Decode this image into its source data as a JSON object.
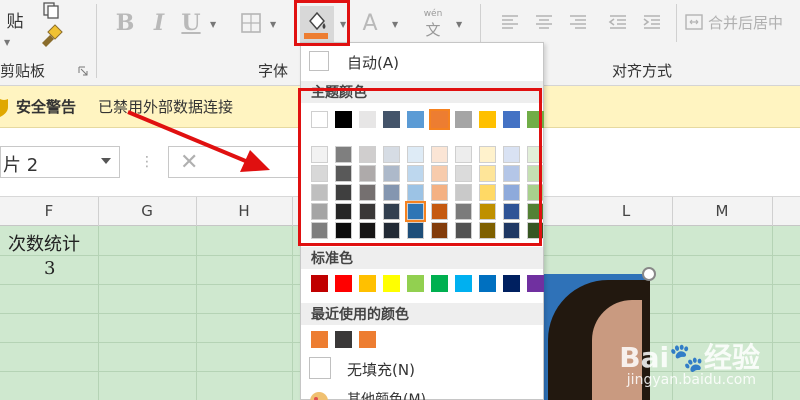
{
  "ribbon": {
    "clipboard": {
      "paste_label": "贴",
      "group_label": "剪贴板"
    },
    "font": {
      "group_label": "字体",
      "bold": "B",
      "italic": "I",
      "underline": "U",
      "font_color": "A",
      "phonetic_top": "wén",
      "phonetic_bottom": "文"
    },
    "alignment": {
      "group_label": "对齐方式",
      "merge_label": "合并后居中"
    }
  },
  "security_bar": {
    "title": "安全警告",
    "message": "已禁用外部数据连接"
  },
  "formula_bar": {
    "name_box": "片 2",
    "cancel_glyph": "✕",
    "divider_glyph": "⋮"
  },
  "sheet": {
    "columns": [
      "F",
      "G",
      "H",
      "L",
      "M"
    ],
    "cells": {
      "f1": "次数统计",
      "f2": "3"
    }
  },
  "color_menu": {
    "auto_label": "自动(A)",
    "theme_header": "主题颜色",
    "standard_header": "标准色",
    "recent_header": "最近使用的颜色",
    "no_fill_label": "无填充(N)",
    "more_label": "其他颜色(M)...",
    "theme_colors": [
      [
        "#ffffff",
        "#000000",
        "#e7e6e6",
        "#44546a",
        "#5b9bd5",
        "#ed7d31",
        "#a5a5a5",
        "#ffc000",
        "#4472c4",
        "#70ad47"
      ],
      [
        "#f2f2f2",
        "#7f7f7f",
        "#d0cece",
        "#d6dce4",
        "#deebf6",
        "#fbe5d5",
        "#ededed",
        "#fff2cc",
        "#d9e2f3",
        "#e2efd9"
      ],
      [
        "#d8d8d8",
        "#595959",
        "#aeaaaa",
        "#adb9ca",
        "#bdd7ee",
        "#f7cbac",
        "#dbdbdb",
        "#fee599",
        "#b4c6e7",
        "#c5e0b3"
      ],
      [
        "#bfbfbf",
        "#3f3f3f",
        "#757070",
        "#8496b0",
        "#9cc3e5",
        "#f4b183",
        "#c9c9c9",
        "#ffd965",
        "#8eaadb",
        "#a8d08d"
      ],
      [
        "#a5a5a5",
        "#262626",
        "#3a3838",
        "#323f4f",
        "#2e75b5",
        "#c55a11",
        "#7b7b7b",
        "#bf9000",
        "#2f5496",
        "#538135"
      ],
      [
        "#7f7f7f",
        "#0c0c0c",
        "#171616",
        "#222a35",
        "#1e4e79",
        "#833c0b",
        "#525252",
        "#7f6000",
        "#1f3864",
        "#375623"
      ]
    ],
    "standard_colors": [
      "#c00000",
      "#ff0000",
      "#ffc000",
      "#ffff00",
      "#92d050",
      "#00b050",
      "#00b0f0",
      "#0070c0",
      "#002060",
      "#7030a0"
    ],
    "recent_colors": [
      "#ed7d31",
      "#3a3838",
      "#ed7d31"
    ],
    "fill_bar_color": "#ed7d31",
    "selected_theme": {
      "row": 0,
      "col": 5
    },
    "selected_grid": {
      "row": 4,
      "col": 4
    }
  },
  "watermark": {
    "brand": "Bai",
    "suffix": "经验",
    "site": "jingyan.baidu.com"
  }
}
